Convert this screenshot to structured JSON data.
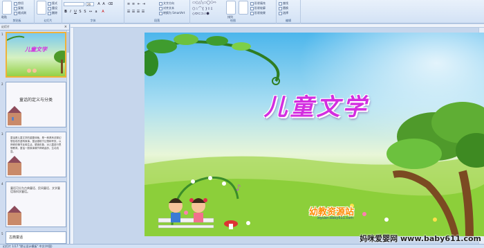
{
  "ribbon": {
    "groups": {
      "clipboard": "剪贴板",
      "slides": "幻灯片",
      "font": "字体",
      "paragraph": "段落",
      "drawing": "绘图",
      "editing": "编辑"
    },
    "clipboard": {
      "paste": "粘贴",
      "cut": "剪切",
      "copy": "复制",
      "format_painter": "格式刷"
    },
    "slides": {
      "new_slide": "新建幻灯片",
      "layout": "版式",
      "reset": "重设",
      "delete": "删除"
    },
    "font": {
      "font_name": "",
      "font_size": "26"
    },
    "paragraph": {
      "text_direction": "文字方向",
      "align_text": "对齐文本",
      "convert_smartart": "转换为 SmartArt"
    },
    "drawing": {
      "arrange": "排列",
      "quick_styles": "快速样式",
      "shape_fill": "形状填充",
      "shape_outline": "形状轮廓",
      "shape_effects": "形状效果"
    },
    "editing": {
      "find": "查找",
      "replace": "替换",
      "select": "选择"
    }
  },
  "left_pane": {
    "tabs_label": "幻灯片",
    "close_icon": "close-icon",
    "slides": [
      {
        "num": "1",
        "title": "儿童文学"
      },
      {
        "num": "2",
        "title": "童话的定义与分类"
      },
      {
        "num": "3",
        "body": "童话是儿童文学的重要体裁，是一种具有浓厚幻想色彩的虚构故事。童话借助于幻想和夸张，以神奇的情节反映生活，塑造形象，对儿童进行思想教育。童话一般故事情节神奇曲折，生动浅显。"
      },
      {
        "num": "4",
        "body": "童话可分为古典童话、民间童话、文学童话和科学童话。"
      },
      {
        "num": "5",
        "title": "古典童话"
      }
    ]
  },
  "slide": {
    "title": "儿童文学",
    "logo_text": "幼教资源站",
    "logo_url": "ziyuan.baby611.com"
  },
  "status_bar": {
    "text": "幻灯片 1/17  \"默认设计模板\"  中文(中国)"
  },
  "watermark": "妈咪爱婴网 www.baby611.com",
  "colors": {
    "title": "#d32ee0",
    "logo": "#ff8a00",
    "sky_top": "#6fc6f0",
    "grass": "#8ccf3a"
  }
}
